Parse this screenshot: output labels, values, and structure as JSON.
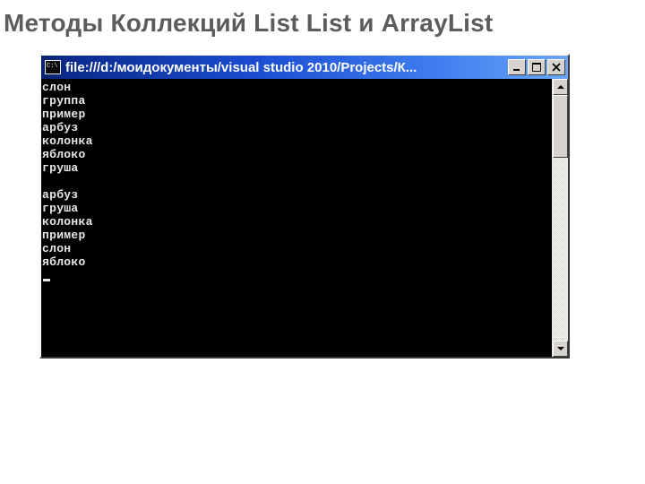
{
  "slide": {
    "title": "Методы Коллекций List List и ArrayList"
  },
  "window": {
    "title": "file:///d:/моидокументы/visual studio 2010/Projects/К...",
    "icon": "console-icon",
    "buttons": {
      "minimize": "minimize",
      "maximize": "maximize",
      "close": "close"
    }
  },
  "console": {
    "group1": [
      "слон",
      "группа",
      "пример",
      "арбуз",
      "колонка",
      "яблоко",
      "груша"
    ],
    "group2": [
      "арбуз",
      "груша",
      "колонка",
      "пример",
      "слон",
      "яблоко"
    ]
  }
}
